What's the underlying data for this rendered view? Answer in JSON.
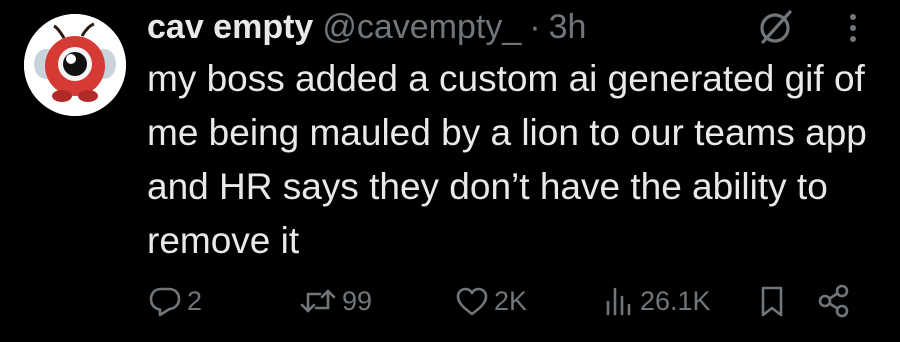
{
  "tweet": {
    "display_name": "cav empty",
    "handle": "@cavempty_",
    "separator": "·",
    "time": "3h",
    "text": "my boss added a custom ai generated gif of me being mauled by a lion to our teams app and HR says they don’t have the ability to remove it"
  },
  "actions": {
    "replies": "2",
    "reposts": "99",
    "likes": "2K",
    "views": "26.1K"
  },
  "icons": {
    "avatar": "avatar-image",
    "grok": "grok-icon",
    "more": "more-icon",
    "reply": "reply-icon",
    "repost": "repost-icon",
    "like": "heart-icon",
    "views": "views-icon",
    "bookmark": "bookmark-icon",
    "share": "share-icon"
  },
  "colors": {
    "background": "#000000",
    "primary_text": "#e7e9ea",
    "secondary_text": "#71767b",
    "avatar_red": "#d63a34"
  }
}
